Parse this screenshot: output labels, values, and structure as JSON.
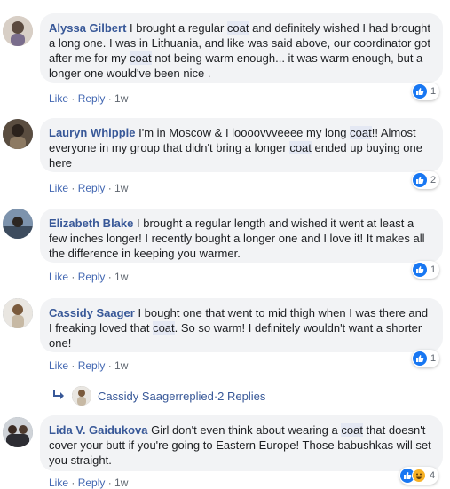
{
  "comments": [
    {
      "name": "Alyssa Gilbert",
      "seg1": " I brought a regular ",
      "hl1": "coat",
      "seg2": " and definitely wished I had brought a long one. I was in Lithuania, and like was said above, our coordinator got after me for my ",
      "hl2": "coat",
      "seg3": " not being warm enough... it was warm enough, but a longer one would've been nice .",
      "like": "Like",
      "reply": "Reply",
      "time": "1w",
      "reaction_count": "1"
    },
    {
      "name": "Lauryn Whipple",
      "seg1": " I'm in Moscow & I loooovvveeee my long ",
      "hl1": "coat",
      "seg2": "!! Almost everyone in my group that didn't bring a longer ",
      "hl2": "coat",
      "seg3": " ended up buying one here",
      "like": "Like",
      "reply": "Reply",
      "time": "1w",
      "reaction_count": "2"
    },
    {
      "name": "Elizabeth Blake",
      "text": " I brought a regular length and wished it went at least a few inches longer! I recently bought a longer one and I love it! It makes all the difference in keeping you warmer.",
      "like": "Like",
      "reply": "Reply",
      "time": "1w",
      "reaction_count": "1"
    },
    {
      "name": "Cassidy Saager",
      "seg1": " I bought one that went to mid thigh when I was there and I freaking loved that ",
      "hl1": "coat",
      "seg2": ". So so warm! I definitely wouldn't want a shorter one!",
      "like": "Like",
      "reply": "Reply",
      "time": "1w",
      "reaction_count": "1"
    },
    {
      "name": "Lida V. Gaidukova",
      "seg1": " Girl don't even think about wearing a ",
      "hl1": "coat",
      "seg2": " that doesn't cover your butt if you're going to Eastern Europe! Those babushkas will set you straight.",
      "like": "Like",
      "reply": "Reply",
      "time": "1w",
      "reaction_count": "4"
    }
  ],
  "replies_link": {
    "name": "Cassidy Saager",
    "action": " replied",
    "dot": " · ",
    "count": "2 Replies"
  },
  "colors": {
    "link": "#385898",
    "action": "#4267b2",
    "bubble": "#f2f3f5",
    "like_blue": "#1877f2",
    "highlight": "#e4e8f3"
  },
  "icons": [
    "avatar",
    "like-reaction-icon",
    "haha-reaction-icon",
    "reply-arrow-icon"
  ]
}
